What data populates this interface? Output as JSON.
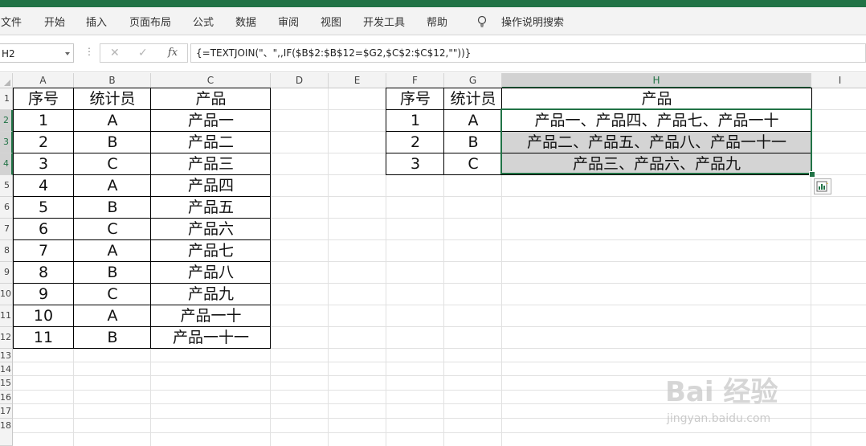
{
  "ribbon": {
    "tabs": [
      "文件",
      "开始",
      "插入",
      "页面布局",
      "公式",
      "数据",
      "审阅",
      "视图",
      "开发工具",
      "帮助"
    ],
    "search_label": "操作说明搜索"
  },
  "formula_bar": {
    "name_box": "H2",
    "fx_label": "fx",
    "formula": "{=TEXTJOIN(\"、\",,IF($B$2:$B$12=$G2,$C$2:$C$12,\"\"))}"
  },
  "columns": [
    "A",
    "B",
    "C",
    "D",
    "E",
    "F",
    "G",
    "H",
    "I"
  ],
  "rows": [
    "1",
    "2",
    "3",
    "4",
    "5",
    "6",
    "7",
    "8",
    "9",
    "10",
    "11",
    "12",
    "13",
    "14",
    "15",
    "16",
    "17",
    "18"
  ],
  "left_table": {
    "headers": [
      "序号",
      "统计员",
      "产品"
    ],
    "rows": [
      [
        "1",
        "A",
        "产品一"
      ],
      [
        "2",
        "B",
        "产品二"
      ],
      [
        "3",
        "C",
        "产品三"
      ],
      [
        "4",
        "A",
        "产品四"
      ],
      [
        "5",
        "B",
        "产品五"
      ],
      [
        "6",
        "C",
        "产品六"
      ],
      [
        "7",
        "A",
        "产品七"
      ],
      [
        "8",
        "B",
        "产品八"
      ],
      [
        "9",
        "C",
        "产品九"
      ],
      [
        "10",
        "A",
        "产品一十"
      ],
      [
        "11",
        "B",
        "产品一十一"
      ]
    ]
  },
  "right_table": {
    "headers": [
      "序号",
      "统计员",
      "产品"
    ],
    "rows": [
      [
        "1",
        "A",
        "产品一、产品四、产品七、产品一十"
      ],
      [
        "2",
        "B",
        "产品二、产品五、产品八、产品一十一"
      ],
      [
        "3",
        "C",
        "产品三、产品六、产品九"
      ]
    ]
  },
  "watermark": {
    "text": "Bai 经验",
    "sub": "jingyan.baidu.com"
  },
  "colors": {
    "accent": "#217346",
    "selection_fill": "#d4d4d4"
  }
}
